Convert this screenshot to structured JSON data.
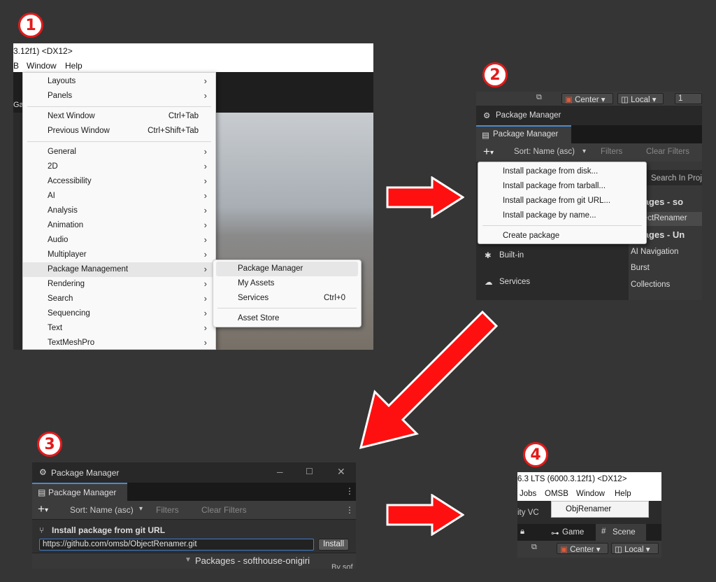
{
  "steps": [
    "1",
    "2",
    "3",
    "4"
  ],
  "panel1": {
    "title": "3.12f1) <DX12>",
    "menubar": [
      "B",
      "Window",
      "Help"
    ],
    "window_menu": [
      {
        "label": "Layouts",
        "submenu": true
      },
      {
        "label": "Panels",
        "submenu": true
      },
      {
        "label": "Next Window",
        "shortcut": "Ctrl+Tab"
      },
      {
        "label": "Previous Window",
        "shortcut": "Ctrl+Shift+Tab"
      },
      {
        "label": "General",
        "submenu": true
      },
      {
        "label": "2D",
        "submenu": true
      },
      {
        "label": "Accessibility",
        "submenu": true
      },
      {
        "label": "AI",
        "submenu": true
      },
      {
        "label": "Analysis",
        "submenu": true
      },
      {
        "label": "Animation",
        "submenu": true
      },
      {
        "label": "Audio",
        "submenu": true
      },
      {
        "label": "Multiplayer",
        "submenu": true
      },
      {
        "label": "Package Management",
        "submenu": true,
        "highlighted": true
      },
      {
        "label": "Rendering",
        "submenu": true
      },
      {
        "label": "Search",
        "submenu": true
      },
      {
        "label": "Sequencing",
        "submenu": true
      },
      {
        "label": "Text",
        "submenu": true
      },
      {
        "label": "TextMeshPro",
        "submenu": true
      }
    ],
    "package_submenu": [
      {
        "label": "Package Manager",
        "highlighted": true
      },
      {
        "label": "My Assets"
      },
      {
        "label": "Services",
        "shortcut": "Ctrl+0"
      },
      {
        "label": "Asset Store"
      }
    ],
    "side_label": "Ga"
  },
  "panel2": {
    "toolbar": {
      "center": "Center",
      "local": "Local",
      "num": "1"
    },
    "window_title": "Package Manager",
    "tab": "Package Manager",
    "sort": "Sort: Name (asc)",
    "filters": "Filters",
    "clear_filters": "Clear Filters",
    "add_menu": [
      "Install package from disk...",
      "Install package from tarball...",
      "Install package from git URL...",
      "Install package by name...",
      "Create package"
    ],
    "search_placeholder": "Search In Proj",
    "sidebar": [
      "Built-in",
      "Services"
    ],
    "list": [
      "ackages - so",
      "ObjectRenamer",
      "ackages - Un",
      "AI Navigation",
      "Burst",
      "Collections"
    ]
  },
  "panel3": {
    "window_title": "Package Manager",
    "tab": "Package Manager",
    "sort": "Sort: Name (asc)",
    "filters": "Filters",
    "clear_filters": "Clear Filters",
    "git_title": "Install package from git URL",
    "url_value": "https://github.com/omsb/ObjectRenamer.git",
    "install": "Install",
    "packages_header": "Packages - softhouse-onigiri",
    "cut_text": "By sof"
  },
  "panel4": {
    "title": "6.3 LTS (6000.3.12f1) <DX12>",
    "menubar": [
      "Jobs",
      "OMSB",
      "Window",
      "Help"
    ],
    "menu_item": "ObjRenamer",
    "side_text": "ity VC",
    "tabs": [
      "Game",
      "Scene"
    ],
    "center": "Center",
    "local": "Local"
  },
  "colors": {
    "accent_red": "#e21b1b",
    "focus_blue": "#3d7fd0"
  }
}
